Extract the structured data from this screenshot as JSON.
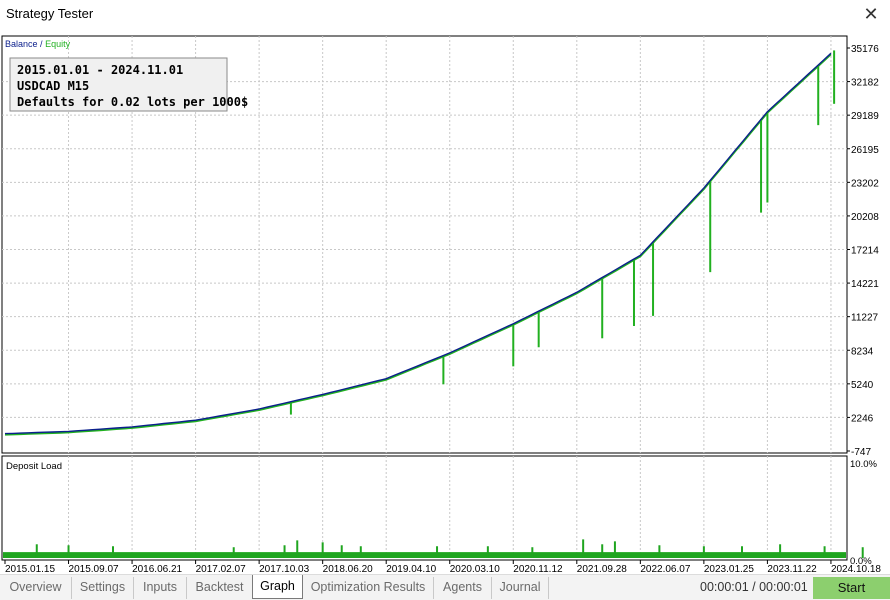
{
  "window": {
    "title": "Strategy Tester",
    "close_symbol": "✕"
  },
  "legend": {
    "balance": "Balance",
    "separator": "/",
    "equity": "Equity"
  },
  "info_box": {
    "period_start": "2015.01.01",
    "period_separator": "-",
    "period_end": "2024.11.01",
    "symbol": "USDCAD M15",
    "defaults": "Defaults for 0.02 lots per 1000$"
  },
  "colors": {
    "balance": "#0b1f8c",
    "equity": "#21b020",
    "deposit_load": "#1fa51f",
    "start_button": "#8ccf6e"
  },
  "chart_data": [
    {
      "type": "line",
      "title": "",
      "series": [
        {
          "name": "Balance",
          "color": "#0b1f8c"
        },
        {
          "name": "Equity",
          "color": "#21b020"
        }
      ],
      "x": [
        "2015.01.15",
        "2015.09.07",
        "2016.06.21",
        "2017.02.07",
        "2017.10.03",
        "2018.06.20",
        "2019.04.10",
        "2020.03.10",
        "2020.11.12",
        "2021.09.28",
        "2022.06.07",
        "2023.01.25",
        "2023.11.22",
        "2024.10.18"
      ],
      "balance": [
        800,
        1000,
        1400,
        2000,
        3000,
        4300,
        5700,
        8000,
        10600,
        13400,
        16700,
        22700,
        29500,
        34700
      ],
      "equity_dips": [
        {
          "x": 4.5,
          "y": 2500
        },
        {
          "x": 6.9,
          "y": 5200
        },
        {
          "x": 8.0,
          "y": 6800
        },
        {
          "x": 8.4,
          "y": 8500
        },
        {
          "x": 9.4,
          "y": 9300
        },
        {
          "x": 9.9,
          "y": 10400
        },
        {
          "x": 10.2,
          "y": 11300
        },
        {
          "x": 11.1,
          "y": 15200
        },
        {
          "x": 11.9,
          "y": 20500
        },
        {
          "x": 12.0,
          "y": 21400
        },
        {
          "x": 12.8,
          "y": 28300
        },
        {
          "x": 13.05,
          "y": 30200
        }
      ],
      "yticks": [
        "35176",
        "32182",
        "29189",
        "26195",
        "23202",
        "20208",
        "17214",
        "14221",
        "11227",
        "8234",
        "5240",
        "2246",
        "-747"
      ],
      "ylim": [
        -747,
        35176
      ],
      "grid": true
    },
    {
      "type": "bar",
      "title": "Deposit Load",
      "ylim_labels": [
        "10.0%",
        "0.0%"
      ],
      "baseline_percent": 0.6,
      "spikes_percent": [
        {
          "x": 0.5,
          "v": 1.4
        },
        {
          "x": 1.0,
          "v": 1.3
        },
        {
          "x": 1.7,
          "v": 1.2
        },
        {
          "x": 3.6,
          "v": 1.1
        },
        {
          "x": 4.4,
          "v": 1.3
        },
        {
          "x": 4.6,
          "v": 1.8
        },
        {
          "x": 5.0,
          "v": 1.6
        },
        {
          "x": 5.3,
          "v": 1.3
        },
        {
          "x": 5.6,
          "v": 1.2
        },
        {
          "x": 6.8,
          "v": 1.2
        },
        {
          "x": 7.6,
          "v": 1.2
        },
        {
          "x": 8.3,
          "v": 1.1
        },
        {
          "x": 9.1,
          "v": 1.9
        },
        {
          "x": 9.4,
          "v": 1.4
        },
        {
          "x": 9.6,
          "v": 1.7
        },
        {
          "x": 10.3,
          "v": 1.3
        },
        {
          "x": 11.0,
          "v": 1.2
        },
        {
          "x": 11.6,
          "v": 1.2
        },
        {
          "x": 12.2,
          "v": 1.4
        },
        {
          "x": 12.9,
          "v": 1.2
        },
        {
          "x": 13.5,
          "v": 1.1
        }
      ]
    }
  ],
  "tabs": [
    "Overview",
    "Settings",
    "Inputs",
    "Backtest",
    "Graph",
    "Optimization Results",
    "Agents",
    "Journal"
  ],
  "active_tab": "Graph",
  "timer": "00:00:01 / 00:00:01",
  "start_label": "Start"
}
